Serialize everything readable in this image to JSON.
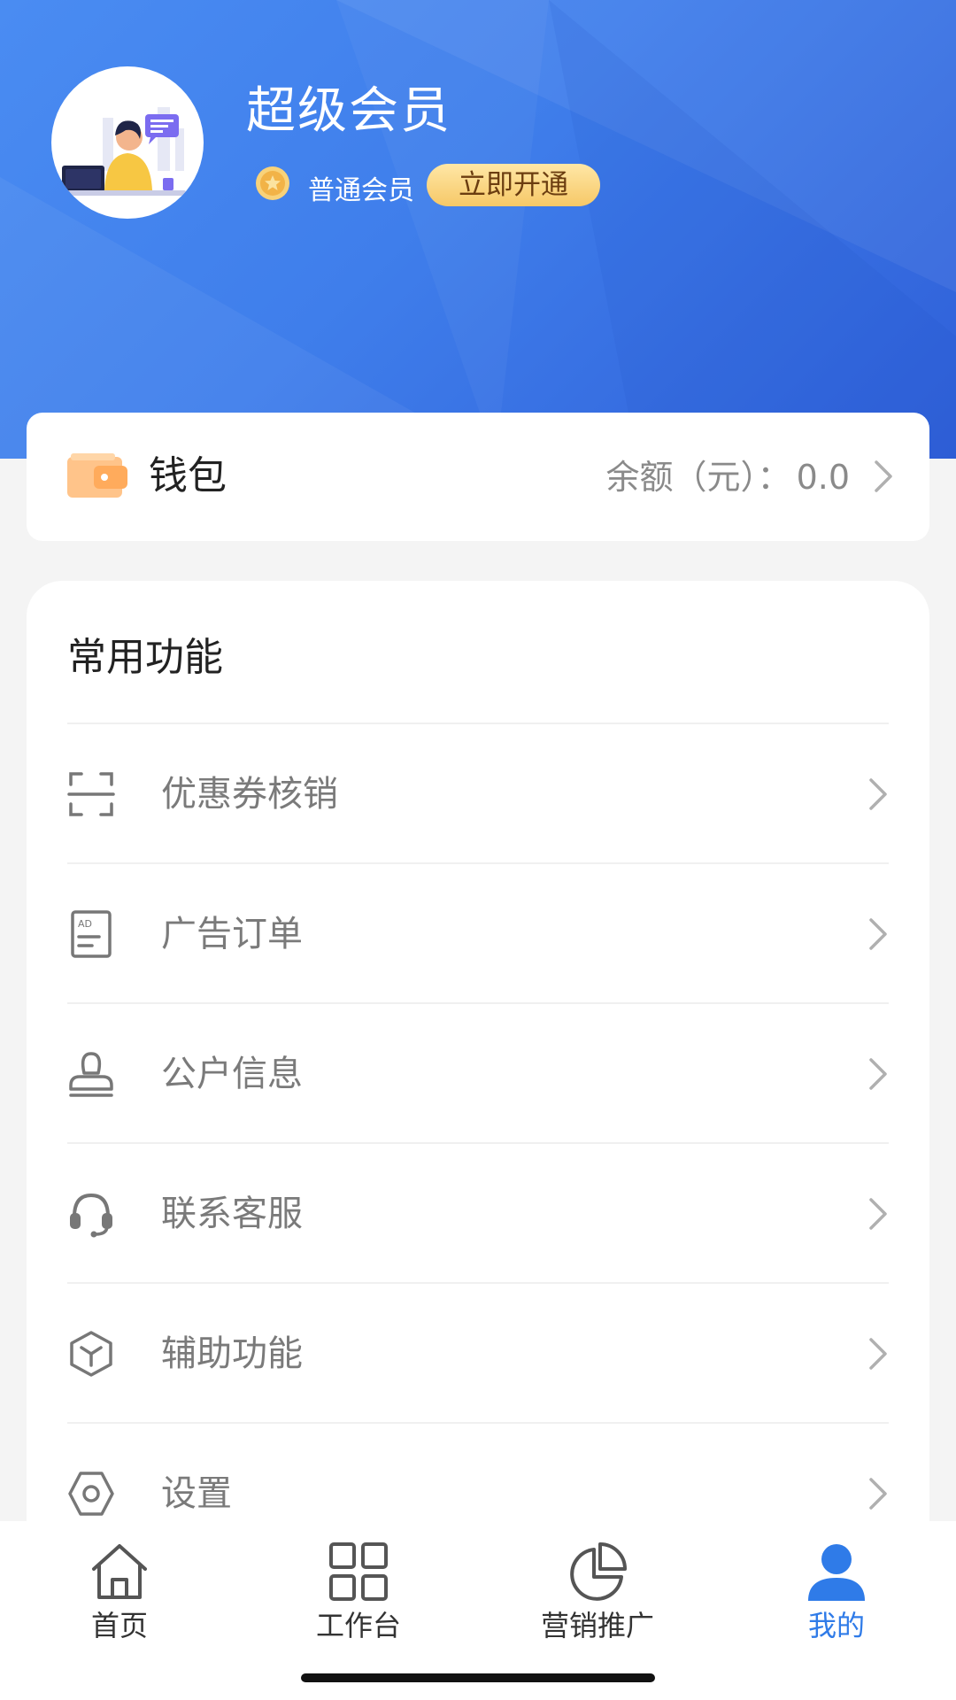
{
  "colors": {
    "primary": "#3f7eeb",
    "active_tab": "#2f7be8",
    "gold_button": "#f6c867",
    "wallet_icon": "#ffab5c",
    "text_gray": "#7a7a7a"
  },
  "profile": {
    "username": "超级会员",
    "member_level": "普通会员",
    "open_button": "立即开通",
    "avatar": "avatar-customer-service-illustration",
    "medal_icon": "gold-medal-icon"
  },
  "wallet": {
    "title": "钱包",
    "balance_label": "余额（元）：",
    "balance_value": "0.0",
    "icon": "wallet-icon"
  },
  "functions": {
    "title": "常用功能",
    "items": [
      {
        "label": "优惠券核销",
        "icon": "scan-icon"
      },
      {
        "label": "广告订单",
        "icon": "ad-order-icon"
      },
      {
        "label": "公户信息",
        "icon": "stamp-icon"
      },
      {
        "label": "联系客服",
        "icon": "headset-icon"
      },
      {
        "label": "辅助功能",
        "icon": "cube-icon"
      },
      {
        "label": "设置",
        "icon": "settings-icon"
      }
    ]
  },
  "tabbar": {
    "tabs": [
      {
        "label": "首页",
        "icon": "home-icon",
        "active": false
      },
      {
        "label": "工作台",
        "icon": "grid-icon",
        "active": false
      },
      {
        "label": "营销推广",
        "icon": "pie-chart-icon",
        "active": false
      },
      {
        "label": "我的",
        "icon": "user-icon",
        "active": true
      }
    ]
  }
}
